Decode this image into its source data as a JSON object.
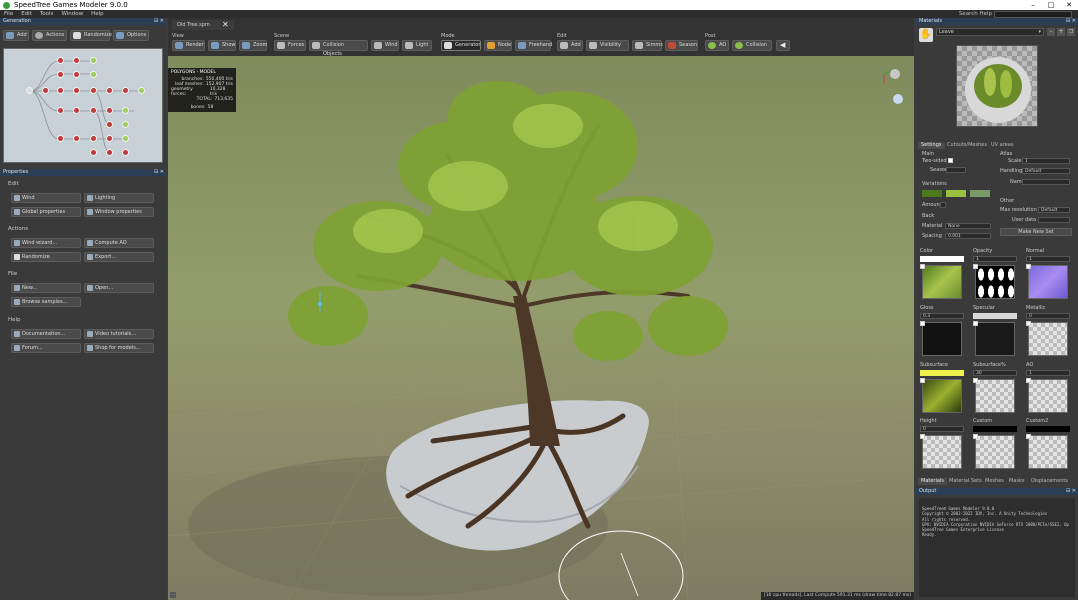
{
  "app": {
    "title": "SpeedTree Games Modeler 9.0.0",
    "search_label": "Search Help"
  },
  "window_controls": {
    "minimize": "–",
    "maximize": "□",
    "close": "✕"
  },
  "menu": [
    "File",
    "Edit",
    "Tools",
    "Window",
    "Help"
  ],
  "generation": {
    "header": "Generation",
    "buttons": {
      "add": "Add",
      "actions": "Actions",
      "randomize": "Randomize",
      "options": "Options"
    }
  },
  "properties": {
    "header": "Properties",
    "sections": {
      "edit": "Edit",
      "actions": "Actions",
      "file": "File",
      "help": "Help"
    },
    "edit": [
      "Wind",
      "Lighting",
      "Global properties",
      "Window properties"
    ],
    "actions": [
      "Wind wizard...",
      "Compute AO",
      "Randomize",
      "Export..."
    ],
    "file": [
      "New...",
      "Open...",
      "Browse samples..."
    ],
    "help": [
      "Documentation...",
      "Video tutorials...",
      "Forum...",
      "Shop for models..."
    ]
  },
  "document_tab": {
    "name": "Old Tree.spm",
    "close": "✕"
  },
  "toolbar": {
    "groups": {
      "view": "View",
      "scene": "Scene",
      "mode": "Mode",
      "edit": "Edit",
      "post": "Post"
    },
    "view": [
      "Render",
      "Show",
      "Zoom"
    ],
    "scene": [
      "Forces",
      "Collision Objects",
      "Wind",
      "Light"
    ],
    "mode": [
      "Generator",
      "Node",
      "Freehand"
    ],
    "edit": [
      "Add",
      "Visibility",
      "Simms",
      "Season"
    ],
    "post": [
      "AO",
      "Collision"
    ]
  },
  "stats": {
    "title": "POLYGONS - MODEL",
    "rows": [
      {
        "label": "branches:",
        "value": "550,400 tris"
      },
      {
        "label": "leaf meshes:",
        "value": "152,907 tris"
      },
      {
        "label": "geometry forces:",
        "value": "10,328 tris"
      },
      {
        "label": "TOTAL:",
        "value": "713,635"
      },
      {
        "label": "bones:",
        "value": "58"
      }
    ]
  },
  "statusbar": "[16 cpu threads], Last Compute 591.31 ms (draw time 82.87 ms)",
  "materials": {
    "header": "Materials",
    "selected": "Leave",
    "tabs": [
      "Settings",
      "Cutouts/Meshes",
      "UV areas"
    ],
    "main_label": "Main",
    "two_sided": "Two-sided",
    "season": "Season",
    "variations": "Variations",
    "amount": "Amount",
    "back": "Back",
    "material_label": "Material",
    "material_value": "None",
    "spacing_label": "Spacing",
    "spacing_value": "0.001",
    "atlas": "Atlas",
    "scale_label": "Scale",
    "scale_value": "1",
    "handling_label": "Handling",
    "handling_value": "Default",
    "name_label": "Name",
    "other": "Other",
    "max_res_label": "Max resolution",
    "max_res_value": "Default",
    "user_data": "User data",
    "make_new_set": "Make New Set",
    "maps": [
      {
        "label": "Color",
        "value": ""
      },
      {
        "label": "Opacity",
        "value": "1"
      },
      {
        "label": "Normal",
        "value": "1"
      },
      {
        "label": "Gloss",
        "value": "0.3"
      },
      {
        "label": "Specular",
        "value": ""
      },
      {
        "label": "Metallic",
        "value": "0"
      },
      {
        "label": "Subsurface",
        "value": ""
      },
      {
        "label": "Subsurface%",
        "value": "30"
      },
      {
        "label": "AO",
        "value": "1"
      },
      {
        "label": "Height",
        "value": "0"
      },
      {
        "label": "Custom",
        "value": ""
      },
      {
        "label": "Custom2",
        "value": ""
      }
    ],
    "bottom_tabs": [
      "Materials",
      "Material Sets",
      "Meshes",
      "Masks",
      "Displacements"
    ]
  },
  "output": {
    "header": "Output",
    "lines": [
      "SpeedTree® Games Modeler 9.0.0",
      "Copyright © 2002-2022 IDV, Inc. A Unity Technologies",
      "All rights reserved.",
      "",
      "GPU: NVIDIA Corporation NVIDIA GeForce RTX 2080/PCIe/SSE2, Op",
      "",
      "SpeedTree Games Enterprise License",
      "",
      "Ready."
    ]
  },
  "colors": {
    "accent": "#2a3f55",
    "panel": "#3c3c3c",
    "viewport_top": "#8f9a68",
    "leaf": "#9cc040"
  }
}
